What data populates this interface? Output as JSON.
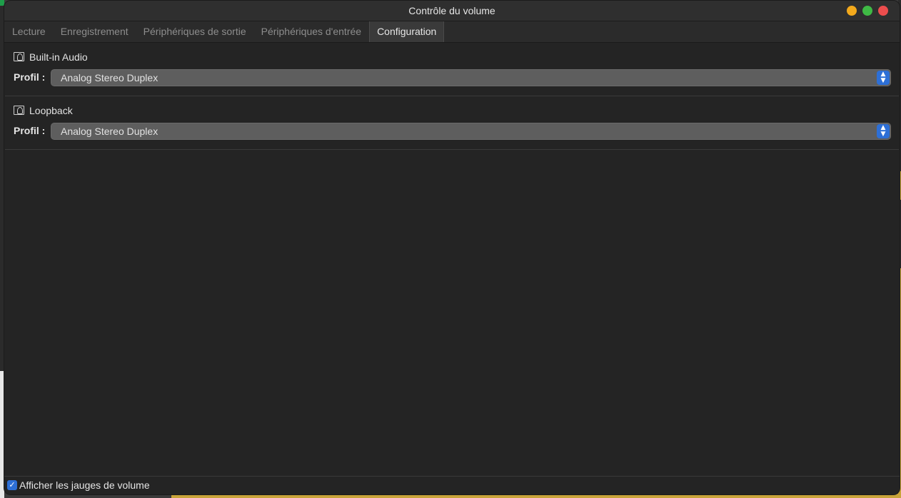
{
  "window": {
    "title": "Contrôle du volume"
  },
  "tabs": [
    {
      "label": "Lecture",
      "active": false
    },
    {
      "label": "Enregistrement",
      "active": false
    },
    {
      "label": "Périphériques de sortie",
      "active": false
    },
    {
      "label": "Périphériques d'entrée",
      "active": false
    },
    {
      "label": "Configuration",
      "active": true
    }
  ],
  "devices": [
    {
      "name": "Built-in Audio",
      "profile_label": "Profil :",
      "profile_value": "Analog Stereo Duplex",
      "icon": "audio-card-icon"
    },
    {
      "name": "Loopback",
      "profile_label": "Profil :",
      "profile_value": "Analog Stereo Duplex",
      "icon": "audio-card-icon"
    }
  ],
  "footer": {
    "checkbox_label": "Afficher les jauges de volume",
    "checked": true
  },
  "colors": {
    "accent": "#2d6fd6",
    "window_bg": "#242424",
    "close": "#ec4d4d",
    "minimize": "#f3a91c",
    "maximize": "#3fba45"
  }
}
